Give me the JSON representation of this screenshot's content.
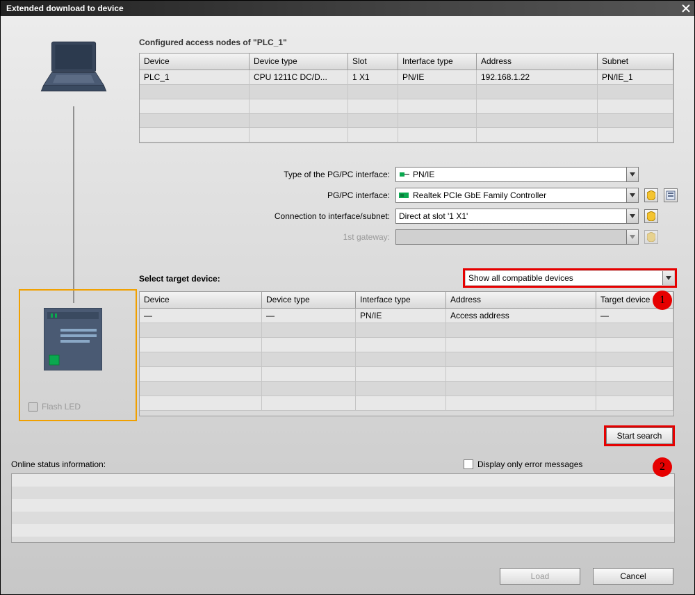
{
  "title": "Extended download to device",
  "configured_heading": "Configured access nodes of \"PLC_1\"",
  "nodes_cols": {
    "device": "Device",
    "type": "Device type",
    "slot": "Slot",
    "iftype": "Interface type",
    "addr": "Address",
    "subnet": "Subnet"
  },
  "nodes_rows": [
    {
      "device": "PLC_1",
      "type": "CPU 1211C DC/D...",
      "slot": "1 X1",
      "iftype": "PN/IE",
      "addr": "192.168.1.22",
      "subnet": "PN/IE_1"
    }
  ],
  "form": {
    "type_label": "Type of the PG/PC interface:",
    "type_value": "PN/IE",
    "pgpc_label": "PG/PC interface:",
    "pgpc_value": "Realtek PCIe GbE Family Controller",
    "conn_label": "Connection to interface/subnet:",
    "conn_value": "Direct at slot '1 X1'",
    "gw_label": "1st gateway:",
    "gw_value": ""
  },
  "flash_led": "Flash LED",
  "select_target_label": "Select target device:",
  "filter_value": "Show all compatible devices",
  "target_cols": {
    "device": "Device",
    "type": "Device type",
    "iftype": "Interface type",
    "addr": "Address",
    "tgt": "Target device"
  },
  "target_rows": [
    {
      "device": "—",
      "type": "—",
      "iftype": "PN/IE",
      "addr": "Access address",
      "tgt": "—"
    }
  ],
  "start_search": "Start search",
  "osi_label": "Online status information:",
  "display_errors": "Display only error messages",
  "buttons": {
    "load": "Load",
    "cancel": "Cancel"
  },
  "marker1": "1",
  "marker2": "2"
}
